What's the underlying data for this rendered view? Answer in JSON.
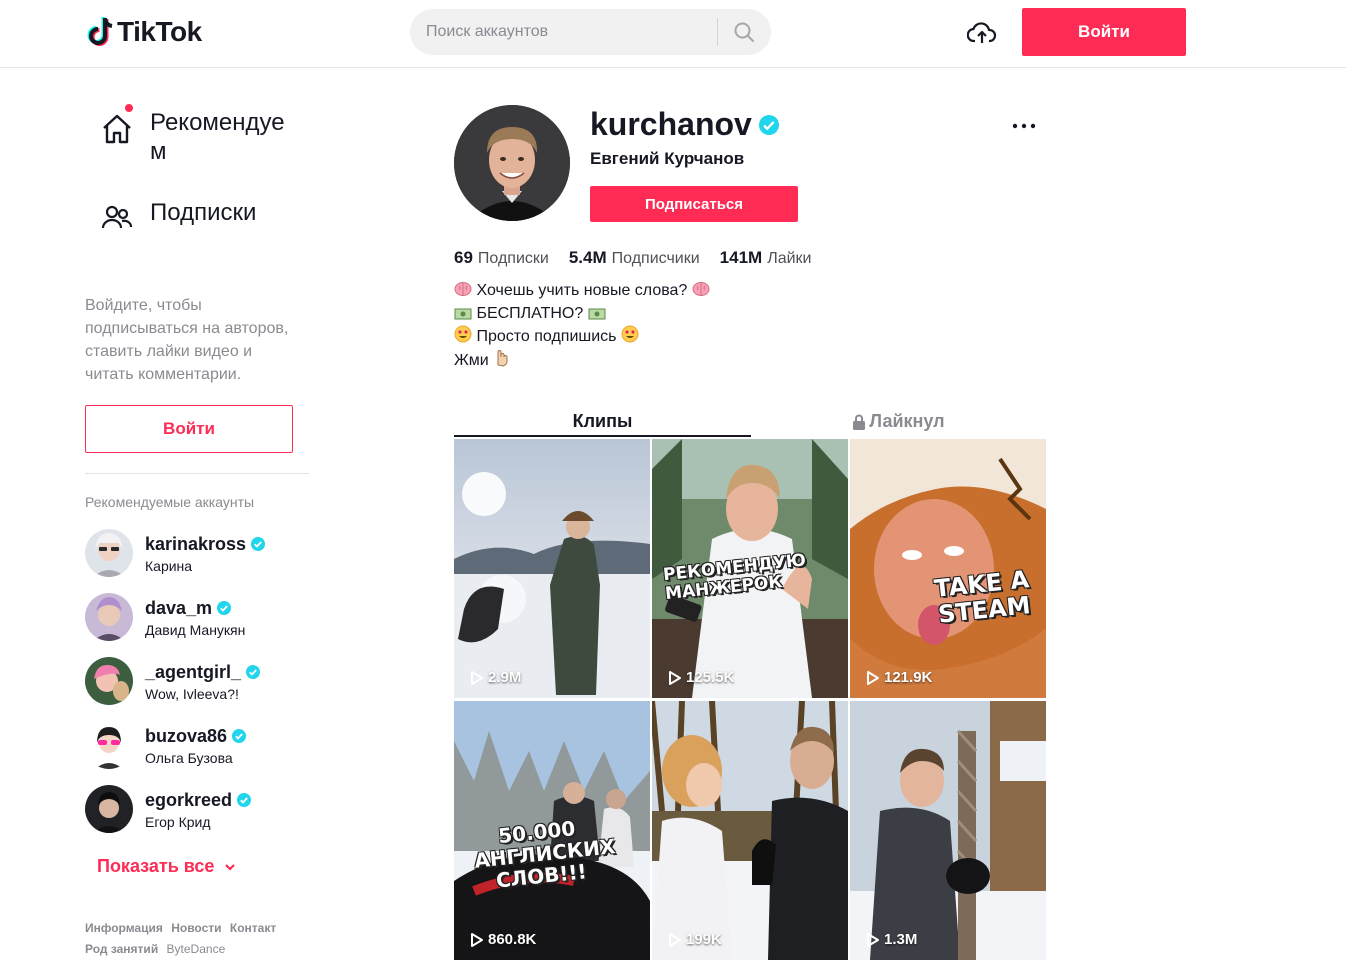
{
  "header": {
    "logo_text": "TikTok",
    "search_placeholder": "Поиск аккаунтов",
    "login_label": "Войти"
  },
  "sidebar": {
    "nav": [
      {
        "label": "Рекомендуем",
        "icon": "home-icon"
      },
      {
        "label": "Подписки",
        "icon": "users-icon"
      }
    ],
    "hint": "Войдите, чтобы подписываться на авторов, ставить лайки видео и читать комментарии.",
    "login_label": "Войти",
    "recommended_title": "Рекомендуемые аккаунты",
    "accounts": [
      {
        "handle": "karinakross",
        "name": "Карина",
        "verified": true
      },
      {
        "handle": "dava_m",
        "name": "Давид Манукян",
        "verified": true
      },
      {
        "handle": "_agentgirl_",
        "name": "Wow, Ivleeva?!",
        "verified": true
      },
      {
        "handle": "buzova86",
        "name": "Ольга Бузова",
        "verified": true
      },
      {
        "handle": "egorkreed",
        "name": "Егор Крид",
        "verified": true
      }
    ],
    "show_all": "Показать все",
    "footer_links": [
      "Информация",
      "Новости",
      "Контакт",
      "Род занятий",
      "ByteDance"
    ]
  },
  "profile": {
    "handle": "kurchanov",
    "name": "Евгений Курчанов",
    "verified": true,
    "follow_label": "Подписаться",
    "stats": [
      {
        "value": "69",
        "label": "Подписки"
      },
      {
        "value": "5.4M",
        "label": "Подписчики"
      },
      {
        "value": "141M",
        "label": "Лайки"
      }
    ],
    "bio": [
      "Хочешь учить новые слова?",
      "БЕСПЛАТНО?",
      "Просто подпишись",
      "Жми"
    ]
  },
  "tabs": [
    {
      "label": "Клипы",
      "active": true
    },
    {
      "label": "Лайкнул",
      "active": false,
      "locked": true
    }
  ],
  "videos": [
    {
      "views": "2.9M",
      "caption": ""
    },
    {
      "views": "125.5K",
      "caption": "РЕКОМЕНДУЮ МАНЖЕРОК"
    },
    {
      "views": "121.9K",
      "caption": "TAKE A STEAM"
    },
    {
      "views": "860.8K",
      "caption": "50.000 АНГЛИСКИХ СЛОВ!!!"
    },
    {
      "views": "199K",
      "caption": ""
    },
    {
      "views": "1.3M",
      "caption": ""
    }
  ],
  "colors": {
    "accent": "#fe2c55",
    "verified": "#20d5ec",
    "text": "#161823",
    "muted": "#8a8b91"
  }
}
